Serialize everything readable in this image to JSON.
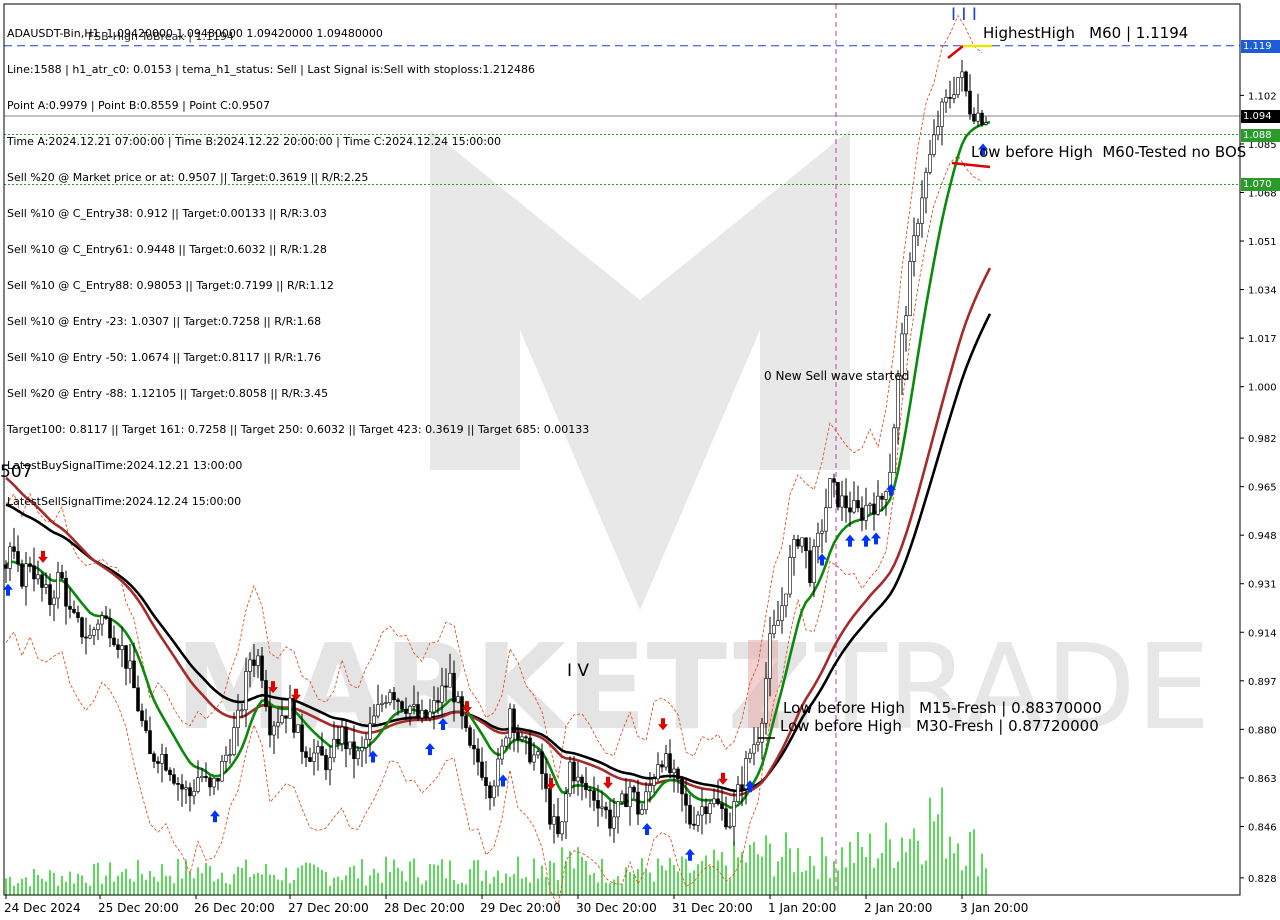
{
  "info_lines": [
    "ADAUSDT-Bin,H1  1.09420000 1.09480000 1.09420000 1.09480000",
    "Line:1588 | h1_atr_c0: 0.0153 | tema_h1_status: Sell | Last Signal is:Sell with stoploss:1.212486",
    "Point A:0.9979 | Point B:0.8559 | Point C:0.9507",
    "Time A:2024.12.21 07:00:00 | Time B:2024.12.22 20:00:00 | Time C:2024.12.24 15:00:00",
    "Sell %20 @ Market price or at: 0.9507 || Target:0.3619 || R/R:2.25",
    "Sell %10 @ C_Entry38: 0.912 || Target:0.00133 || R/R:3.03",
    "Sell %10 @ C_Entry61: 0.9448 || Target:0.6032 || R/R:1.28",
    "Sell %10 @ C_Entry88: 0.98053 || Target:0.7199 || R/R:1.12",
    "Sell %10 @ Entry -23: 1.0307 || Target:0.7258 || R/R:1.68",
    "Sell %10 @ Entry -50: 1.0674 || Target:0.8117 || R/R:1.76",
    "Sell %20 @ Entry -88: 1.12105 || Target:0.8058 || R/R:3.45",
    "Target100: 0.8117 || Target 161: 0.7258 || Target 250: 0.6032 || Target 423: 0.3619 || Target 685: 0.00133",
    "LatestBuySignalTime:2024.12.21 13:00:00",
    "LatestSellSignalTime:2024.12.24 15:00:00"
  ],
  "overlap_text": "FSB-High ToBreak | 1.1194",
  "annotations": {
    "highest_high": "HighestHigh   M60 | 1.1194",
    "low_before_high_m60": "Low before High  M60-Tested no BOS",
    "low_m15": "Low before High   M15-Fresh | 0.88370000",
    "low_m30": "Low before High   M30-Fresh | 0.87720000",
    "sell_wave": "0 New Sell wave started",
    "wave_iv": "I V",
    "wave_iii": "I I I",
    "left_cut": "507"
  },
  "price_tags": [
    {
      "price": 1.1194,
      "label": "1.119",
      "bg": "#1e5bd6",
      "fg": "#ffffff"
    },
    {
      "price": 1.0948,
      "label": "1.094",
      "bg": "#000000",
      "fg": "#ffffff"
    },
    {
      "price": 1.0883,
      "label": "1.088",
      "bg": "#2a9a2a",
      "fg": "#ffffff"
    },
    {
      "price": 1.0708,
      "label": "1.070",
      "bg": "#2a9a2a",
      "fg": "#ffffff"
    }
  ],
  "colors": {
    "bull": "#000000",
    "bear": "#000000",
    "ema_green": "#0a8a0a",
    "ema_black": "#000000",
    "ema_red": "#a52a2a",
    "band_red": "#e04010",
    "volume": "#22cc22",
    "blue_line": "#1e3fd6",
    "green_dot": "#2a9a2a",
    "buy_arrow": "#0033ff",
    "sell_arrow": "#e00000",
    "vline": "#cc3399"
  },
  "chart_data": {
    "type": "candlestick",
    "symbol": "ADAUSDT-Bin",
    "timeframe": "H1",
    "ylim": [
      0.822,
      1.134
    ],
    "y_ticks": [
      "1.102",
      "1.085",
      "1.068",
      "1.051",
      "1.034",
      "1.017",
      "1.000",
      "0.982",
      "0.965",
      "0.948",
      "0.931",
      "0.914",
      "0.897",
      "0.880",
      "0.863",
      "0.846",
      "0.828"
    ],
    "x_ticks": [
      "24 Dec 2024",
      "25 Dec 20:00",
      "26 Dec 20:00",
      "27 Dec 20:00",
      "28 Dec 20:00",
      "29 Dec 20:00",
      "30 Dec 20:00",
      "31 Dec 20:00",
      "1 Jan 20:00",
      "2 Jan 20:00",
      "3 Jan 20:00"
    ],
    "horizontal_levels": [
      {
        "price": 1.1194,
        "style": "dashed",
        "color": "#1e3fd6"
      },
      {
        "price": 1.0948,
        "style": "solid",
        "color": "#8a8a8a"
      },
      {
        "price": 1.0883,
        "style": "dotted",
        "color": "#2a9a2a"
      },
      {
        "price": 1.0708,
        "style": "dotted",
        "color": "#2a9a2a"
      }
    ],
    "price_path": [
      [
        0,
        0.928
      ],
      [
        10,
        0.944
      ],
      [
        20,
        0.932
      ],
      [
        30,
        0.939
      ],
      [
        40,
        0.93
      ],
      [
        50,
        0.925
      ],
      [
        60,
        0.935
      ],
      [
        70,
        0.92
      ],
      [
        80,
        0.915
      ],
      [
        90,
        0.912
      ],
      [
        100,
        0.92
      ],
      [
        110,
        0.916
      ],
      [
        120,
        0.91
      ],
      [
        130,
        0.9
      ],
      [
        140,
        0.885
      ],
      [
        150,
        0.87
      ],
      [
        160,
        0.872
      ],
      [
        170,
        0.867
      ],
      [
        180,
        0.86
      ],
      [
        190,
        0.857
      ],
      [
        200,
        0.865
      ],
      [
        210,
        0.858
      ],
      [
        220,
        0.865
      ],
      [
        230,
        0.875
      ],
      [
        240,
        0.885
      ],
      [
        250,
        0.905
      ],
      [
        260,
        0.905
      ],
      [
        270,
        0.882
      ],
      [
        280,
        0.885
      ],
      [
        290,
        0.888
      ],
      [
        300,
        0.875
      ],
      [
        310,
        0.872
      ],
      [
        320,
        0.87
      ],
      [
        330,
        0.868
      ],
      [
        340,
        0.88
      ],
      [
        350,
        0.872
      ],
      [
        360,
        0.87
      ],
      [
        370,
        0.88
      ],
      [
        380,
        0.888
      ],
      [
        390,
        0.895
      ],
      [
        400,
        0.89
      ],
      [
        410,
        0.888
      ],
      [
        420,
        0.883
      ],
      [
        430,
        0.885
      ],
      [
        440,
        0.892
      ],
      [
        450,
        0.898
      ],
      [
        460,
        0.885
      ],
      [
        470,
        0.872
      ],
      [
        480,
        0.868
      ],
      [
        490,
        0.86
      ],
      [
        500,
        0.868
      ],
      [
        510,
        0.888
      ],
      [
        520,
        0.875
      ],
      [
        530,
        0.872
      ],
      [
        540,
        0.868
      ],
      [
        550,
        0.85
      ],
      [
        560,
        0.84
      ],
      [
        570,
        0.868
      ],
      [
        580,
        0.86
      ],
      [
        590,
        0.858
      ],
      [
        600,
        0.855
      ],
      [
        610,
        0.848
      ],
      [
        620,
        0.852
      ],
      [
        630,
        0.86
      ],
      [
        640,
        0.85
      ],
      [
        650,
        0.86
      ],
      [
        660,
        0.872
      ],
      [
        670,
        0.865
      ],
      [
        680,
        0.858
      ],
      [
        690,
        0.848
      ],
      [
        700,
        0.852
      ],
      [
        710,
        0.856
      ],
      [
        720,
        0.852
      ],
      [
        730,
        0.848
      ],
      [
        740,
        0.86
      ],
      [
        750,
        0.872
      ],
      [
        760,
        0.88
      ],
      [
        770,
        0.91
      ],
      [
        780,
        0.92
      ],
      [
        790,
        0.938
      ],
      [
        800,
        0.95
      ],
      [
        810,
        0.935
      ],
      [
        820,
        0.948
      ],
      [
        830,
        0.965
      ],
      [
        840,
        0.96
      ],
      [
        850,
        0.958
      ],
      [
        860,
        0.955
      ],
      [
        870,
        0.96
      ],
      [
        880,
        0.958
      ],
      [
        890,
        0.972
      ],
      [
        900,
        1.01
      ],
      [
        910,
        1.04
      ],
      [
        920,
        1.065
      ],
      [
        930,
        1.08
      ],
      [
        940,
        1.095
      ],
      [
        950,
        1.102
      ],
      [
        960,
        1.11
      ],
      [
        970,
        1.098
      ],
      [
        980,
        1.095
      ],
      [
        990,
        1.0948
      ]
    ],
    "volume_peaks": [
      [
        0,
        0.2
      ],
      [
        100,
        0.25
      ],
      [
        200,
        0.3
      ],
      [
        300,
        0.25
      ],
      [
        400,
        0.3
      ],
      [
        500,
        0.3
      ],
      [
        560,
        0.45
      ],
      [
        600,
        0.3
      ],
      [
        700,
        0.3
      ],
      [
        760,
        0.5
      ],
      [
        820,
        0.45
      ],
      [
        880,
        0.55
      ],
      [
        935,
        0.95
      ],
      [
        990,
        0.4
      ]
    ]
  }
}
